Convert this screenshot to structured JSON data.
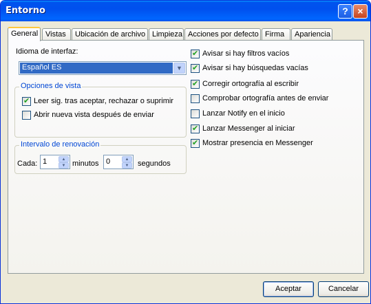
{
  "window": {
    "title": "Entorno",
    "help": "?",
    "close": "×"
  },
  "tabs": [
    "General",
    "Vistas",
    "Ubicación de archivo",
    "Limpieza",
    "Acciones por defecto",
    "Firma",
    "Apariencia"
  ],
  "language": {
    "label": "Idioma de interfaz:",
    "value": "Español   ES"
  },
  "view_options": {
    "legend": "Opciones de vista",
    "items": [
      {
        "label": "Leer sig. tras aceptar, rechazar o suprimir",
        "checked": true
      },
      {
        "label": "Abrir nueva vista después de enviar",
        "checked": false
      }
    ]
  },
  "refresh": {
    "legend": "Intervalo de renovación",
    "cada": "Cada:",
    "minutes_value": "1",
    "minutes_label": "minutos",
    "seconds_value": "0",
    "seconds_label": "segundos"
  },
  "right_options": [
    {
      "label": "Avisar si hay filtros vacíos",
      "checked": true
    },
    {
      "label": "Avisar si hay búsquedas vacías",
      "checked": true
    },
    {
      "label": "Corregir ortografía al escribir",
      "checked": true
    },
    {
      "label": "Comprobar ortografía antes de enviar",
      "checked": false
    },
    {
      "label": "Lanzar Notify en el inicio",
      "checked": false
    },
    {
      "label": "Lanzar Messenger al iniciar",
      "checked": true
    },
    {
      "label": "Mostrar presencia en Messenger",
      "checked": true
    }
  ],
  "buttons": {
    "accept": "Aceptar",
    "cancel": "Cancelar"
  }
}
